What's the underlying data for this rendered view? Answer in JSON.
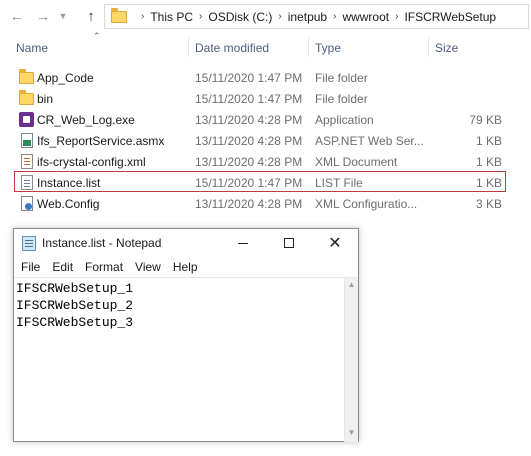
{
  "address_bar": {
    "crumbs": [
      "This PC",
      "OSDisk (C:)",
      "inetpub",
      "wwwroot",
      "IFSCRWebSetup"
    ]
  },
  "columns": {
    "name": "Name",
    "date": "Date modified",
    "type": "Type",
    "size": "Size"
  },
  "files": [
    {
      "name": "App_Code",
      "date": "15/11/2020 1:47 PM",
      "type": "File folder",
      "size": "",
      "icon": "folder-icon"
    },
    {
      "name": "bin",
      "date": "15/11/2020 1:47 PM",
      "type": "File folder",
      "size": "",
      "icon": "folder-icon"
    },
    {
      "name": "CR_Web_Log.exe",
      "date": "13/11/2020 4:28 PM",
      "type": "Application",
      "size": "79 KB",
      "icon": "application-icon"
    },
    {
      "name": "Ifs_ReportService.asmx",
      "date": "13/11/2020 4:28 PM",
      "type": "ASP.NET Web Ser...",
      "size": "1 KB",
      "icon": "asmx-file-icon"
    },
    {
      "name": "ifs-crystal-config.xml",
      "date": "13/11/2020 4:28 PM",
      "type": "XML Document",
      "size": "1 KB",
      "icon": "xml-file-icon"
    },
    {
      "name": "Instance.list",
      "date": "15/11/2020 1:47 PM",
      "type": "LIST File",
      "size": "1 KB",
      "icon": "file-icon"
    },
    {
      "name": "Web.Config",
      "date": "13/11/2020 4:28 PM",
      "type": "XML Configuratio...",
      "size": "3 KB",
      "icon": "config-file-icon"
    }
  ],
  "highlight_color": "#c0393b",
  "notepad": {
    "title": "Instance.list - Notepad",
    "menu": [
      "File",
      "Edit",
      "Format",
      "View",
      "Help"
    ],
    "content": "IFSCRWebSetup_1\nIFSCRWebSetup_2\nIFSCRWebSetup_3"
  }
}
